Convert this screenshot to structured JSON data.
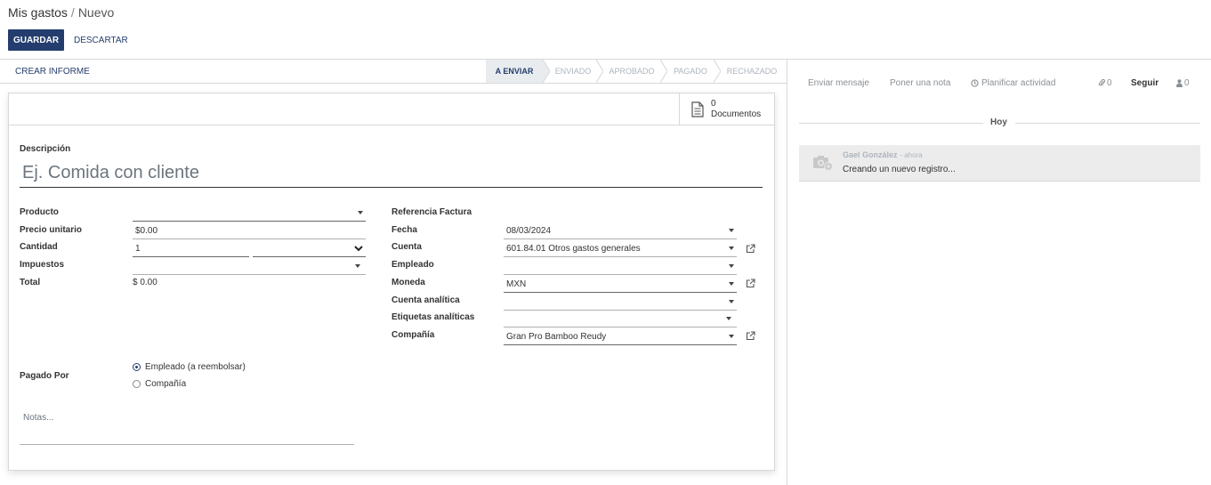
{
  "breadcrumb": {
    "parent": "Mis gastos",
    "separator": "/",
    "current": "Nuevo"
  },
  "buttons": {
    "save": "GUARDAR",
    "discard": "DESCARTAR"
  },
  "statusbar": {
    "create_report": "CREAR INFORME",
    "stages": [
      "A ENVIAR",
      "ENVIADO",
      "APROBADO",
      "PAGADO",
      "RECHAZADO"
    ],
    "active_stage": "A ENVIAR"
  },
  "smart_button": {
    "count": "0",
    "label": "Documentos"
  },
  "form": {
    "description_label": "Descripción",
    "description_placeholder": "Ej. Comida con cliente",
    "product_label": "Producto",
    "unit_price_label": "Precio unitario",
    "unit_price": "$0.00",
    "quantity_label": "Cantidad",
    "quantity": "1",
    "taxes_label": "Impuestos",
    "total_label": "Total",
    "total": "$ 0.00",
    "invoice_ref_label": "Referencia Factura",
    "date_label": "Fecha",
    "date": "08/03/2024",
    "account_label": "Cuenta",
    "account": "601.84.01 Otros gastos generales",
    "employee_label": "Empleado",
    "currency_label": "Moneda",
    "currency": "MXN",
    "analytic_account_label": "Cuenta analítica",
    "analytic_tags_label": "Etiquetas analíticas",
    "company_label": "Compañía",
    "company": "Gran Pro Bamboo Reudy",
    "paid_by_label": "Pagado Por",
    "paid_by_options": [
      "Empleado (a reembolsar)",
      "Compañía"
    ],
    "notes_placeholder": "Notas..."
  },
  "chatter": {
    "send_message": "Enviar mensaje",
    "log_note": "Poner una nota",
    "schedule_activity": "Planificar actividad",
    "attachments_count": "0",
    "follow": "Seguir",
    "followers_count": "0",
    "date_separator": "Hoy",
    "message": {
      "author": "Gael González",
      "time": "- ahora",
      "body": "Creando un nuevo registro..."
    }
  },
  "colors": {
    "primary": "#243d6e",
    "muted": "#adb5bd",
    "active_stage_bg": "#e9ecef"
  },
  "icons": [
    "document-icon",
    "caret-down-icon",
    "external-link-icon",
    "clock-icon",
    "paperclip-icon",
    "user-icon",
    "camera-avatar-icon"
  ]
}
